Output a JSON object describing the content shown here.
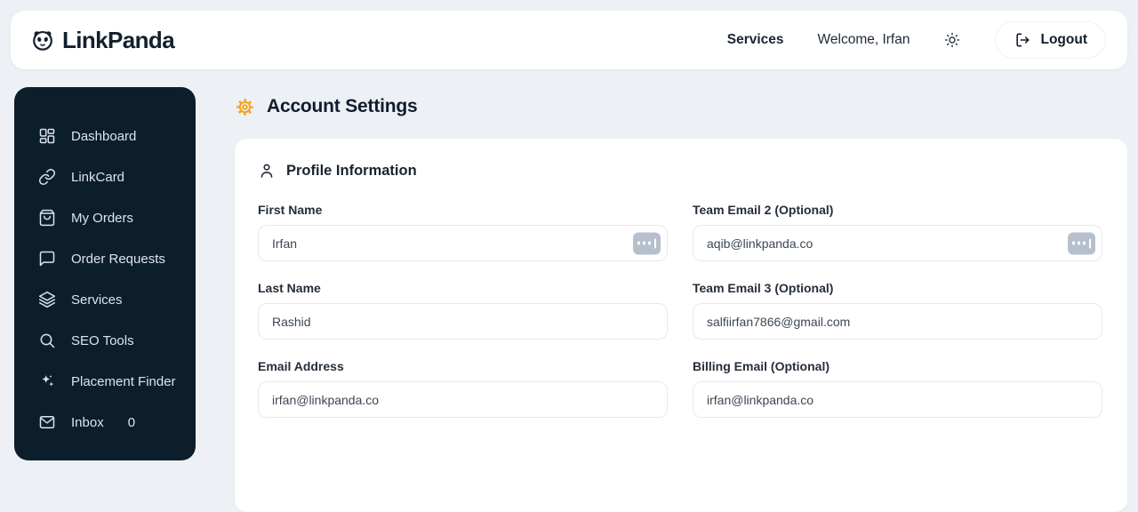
{
  "colors": {
    "brand_navy": "#14202f",
    "sidebar_bg": "#0c1e2c",
    "accent_orange": "#F2A51C",
    "page_bg": "#edf1f6",
    "autofill_badge_bg": "#b6c0cc"
  },
  "header": {
    "logo_text": "LinkPanda",
    "logo_icon": "panda-face-icon",
    "nav": {
      "services": "Services",
      "welcome": "Welcome, Irfan",
      "theme_icon": "sun-icon",
      "logout_icon": "logout-arrow-icon",
      "logout": "Logout"
    }
  },
  "sidebar": {
    "items": [
      {
        "label": "Dashboard",
        "icon": "dashboard-grid-icon"
      },
      {
        "label": "LinkCard",
        "icon": "link-icon"
      },
      {
        "label": "My Orders",
        "icon": "shopping-bag-icon"
      },
      {
        "label": "Order Requests",
        "icon": "chat-bubble-icon"
      },
      {
        "label": "Services",
        "icon": "layers-icon"
      },
      {
        "label": "SEO Tools",
        "icon": "search-icon"
      },
      {
        "label": "Placement Finder",
        "icon": "sparkles-icon"
      },
      {
        "label": "Inbox",
        "icon": "envelope-icon",
        "badge": "0"
      }
    ]
  },
  "main": {
    "page_title": "Account Settings",
    "page_title_icon": "gear-icon",
    "card": {
      "title": "Profile Information",
      "title_icon": "user-icon",
      "fields": [
        {
          "label": "First Name",
          "value": "Irfan",
          "autofill_badge": true
        },
        {
          "label": "Team Email 2 (Optional)",
          "value": "aqib@linkpanda.co",
          "autofill_badge": true
        },
        {
          "label": "Last Name",
          "value": "Rashid",
          "autofill_badge": false
        },
        {
          "label": "Team Email 3 (Optional)",
          "value": "salfiirfan7866@gmail.com",
          "autofill_badge": false
        },
        {
          "label": "Email Address",
          "value": "irfan@linkpanda.co",
          "autofill_badge": false
        },
        {
          "label": "Billing Email (Optional)",
          "value": "irfan@linkpanda.co",
          "autofill_badge": false
        }
      ]
    }
  }
}
